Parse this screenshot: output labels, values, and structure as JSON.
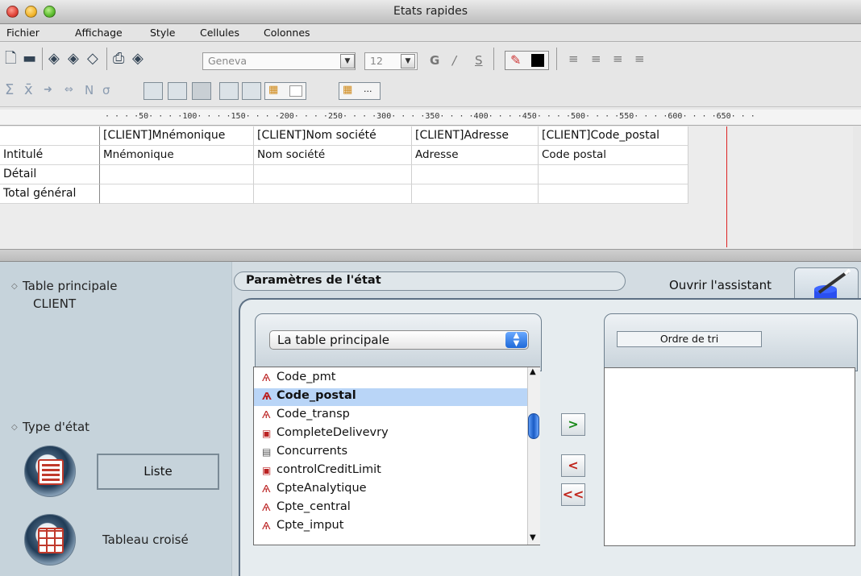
{
  "window": {
    "title": "Etats rapides"
  },
  "menu": [
    "Fichier",
    "Affichage",
    "Style",
    "Cellules",
    "Colonnes"
  ],
  "toolbar": {
    "font_name": "Geneva",
    "font_size": "12",
    "bold": "G",
    "italic": "/",
    "underline": "S",
    "fill_more": "..."
  },
  "ruler": {
    "text": "· · · ·50· · · ·100· · · ·150· · · ·200· · · ·250· · · ·300· · · ·350· · · ·400· · · ·450· · · ·500· · · ·550· · · ·600· · · ·650· · ·"
  },
  "grid": {
    "columns": [
      "[CLIENT]Mnémonique",
      "[CLIENT]Nom société",
      "[CLIENT]Adresse",
      "[CLIENT]Code_postal"
    ],
    "rows": [
      {
        "label": "Intitulé",
        "cells": [
          "Mnémonique",
          "Nom société",
          "Adresse",
          "Code postal"
        ]
      },
      {
        "label": "Détail",
        "cells": [
          "",
          "",
          "",
          ""
        ]
      },
      {
        "label": "Total général",
        "cells": [
          "",
          "",
          "",
          ""
        ]
      }
    ]
  },
  "left": {
    "table_label": "Table principale",
    "table_value": "CLIENT",
    "type_label": "Type d'état",
    "type_list": "Liste",
    "type_cross": "Tableau croisé"
  },
  "params": {
    "title": "Paramètres de l'état",
    "assistant": "Ouvrir l'assistant",
    "table_select": "La table principale",
    "fields": [
      "Code_pmt",
      "Code_postal",
      "Code_transp",
      "CompleteDelivevry",
      "Concurrents",
      "controlCreditLimit",
      "CpteAnalytique",
      "Cpte_central",
      "Cpte_imput"
    ],
    "selected_field": "Code_postal",
    "sort_label": "Ordre de tri",
    "btn_add": ">",
    "btn_remove": "<",
    "btn_remove_all": "<<"
  },
  "colors": {
    "accent": "#1f69d8",
    "selection": "#b9d5f7",
    "marker": "#dd2222"
  }
}
